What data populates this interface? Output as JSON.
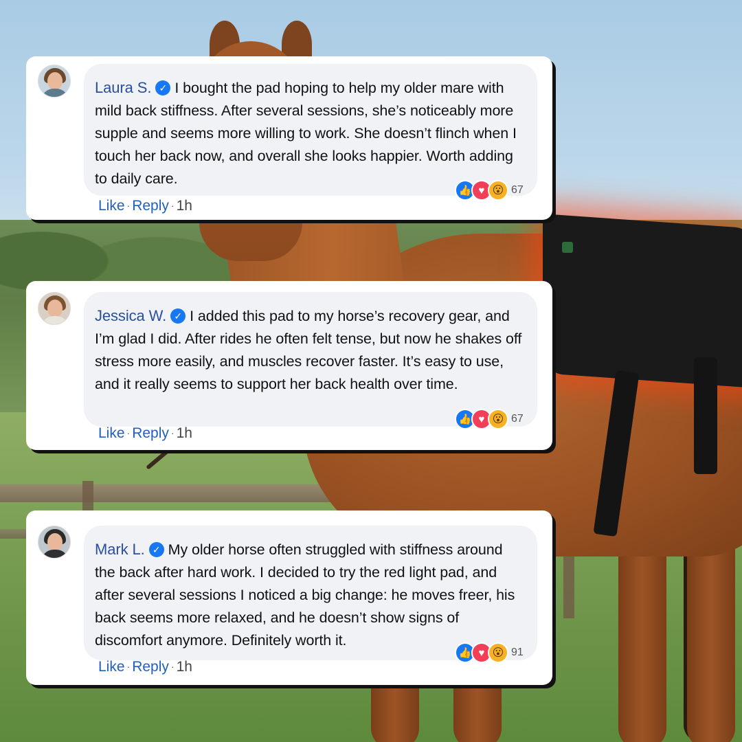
{
  "comments": [
    {
      "name": "Laura S.",
      "text": "I bought the pad hoping to help my older mare with mild back stiffness. After several sessions, she’s noticeably more supple and seems more willing to work. She doesn’t flinch when I touch her back now, and overall she looks happier. Worth adding to daily care.",
      "reaction_count": "67",
      "like_label": "Like",
      "reply_label": "Reply",
      "time": "1h",
      "avatar": {
        "hair": "#6b4a2b",
        "shirt": "#5d7b8e",
        "bg": "#c9d6df"
      }
    },
    {
      "name": "Jessica W.",
      "text": "I added this pad to my horse’s recovery gear, and I’m glad I did. After rides he often felt tense, but now he shakes off stress more easily, and muscles recover faster. It’s easy to use, and it really seems to support her back health over time.",
      "reaction_count": "67",
      "like_label": "Like",
      "reply_label": "Reply",
      "time": "1h",
      "avatar": {
        "hair": "#7a5232",
        "shirt": "#e9e4dc",
        "bg": "#d9cfc3"
      }
    },
    {
      "name": "Mark L.",
      "text": "My older horse often struggled with stiffness around the back after hard work. I decided to try the red light pad, and after several sessions I noticed a big change: he moves freer, his back seems more relaxed, and he doesn’t show signs of discomfort anymore. Definitely worth it.",
      "reaction_count": "91",
      "like_label": "Like",
      "reply_label": "Reply",
      "time": "1h",
      "avatar": {
        "hair": "#2b2b2b",
        "shirt": "#2f2f33",
        "bg": "#bfc7cc"
      }
    }
  ],
  "icons": {
    "verified": "verified-check-icon",
    "reactions": [
      "like-reaction-icon",
      "love-reaction-icon",
      "wow-reaction-icon"
    ]
  },
  "colors": {
    "name": "#2a4f9c",
    "link": "#1f5fbf",
    "bubble": "#f0f2f5",
    "verified": "#1877f2"
  }
}
